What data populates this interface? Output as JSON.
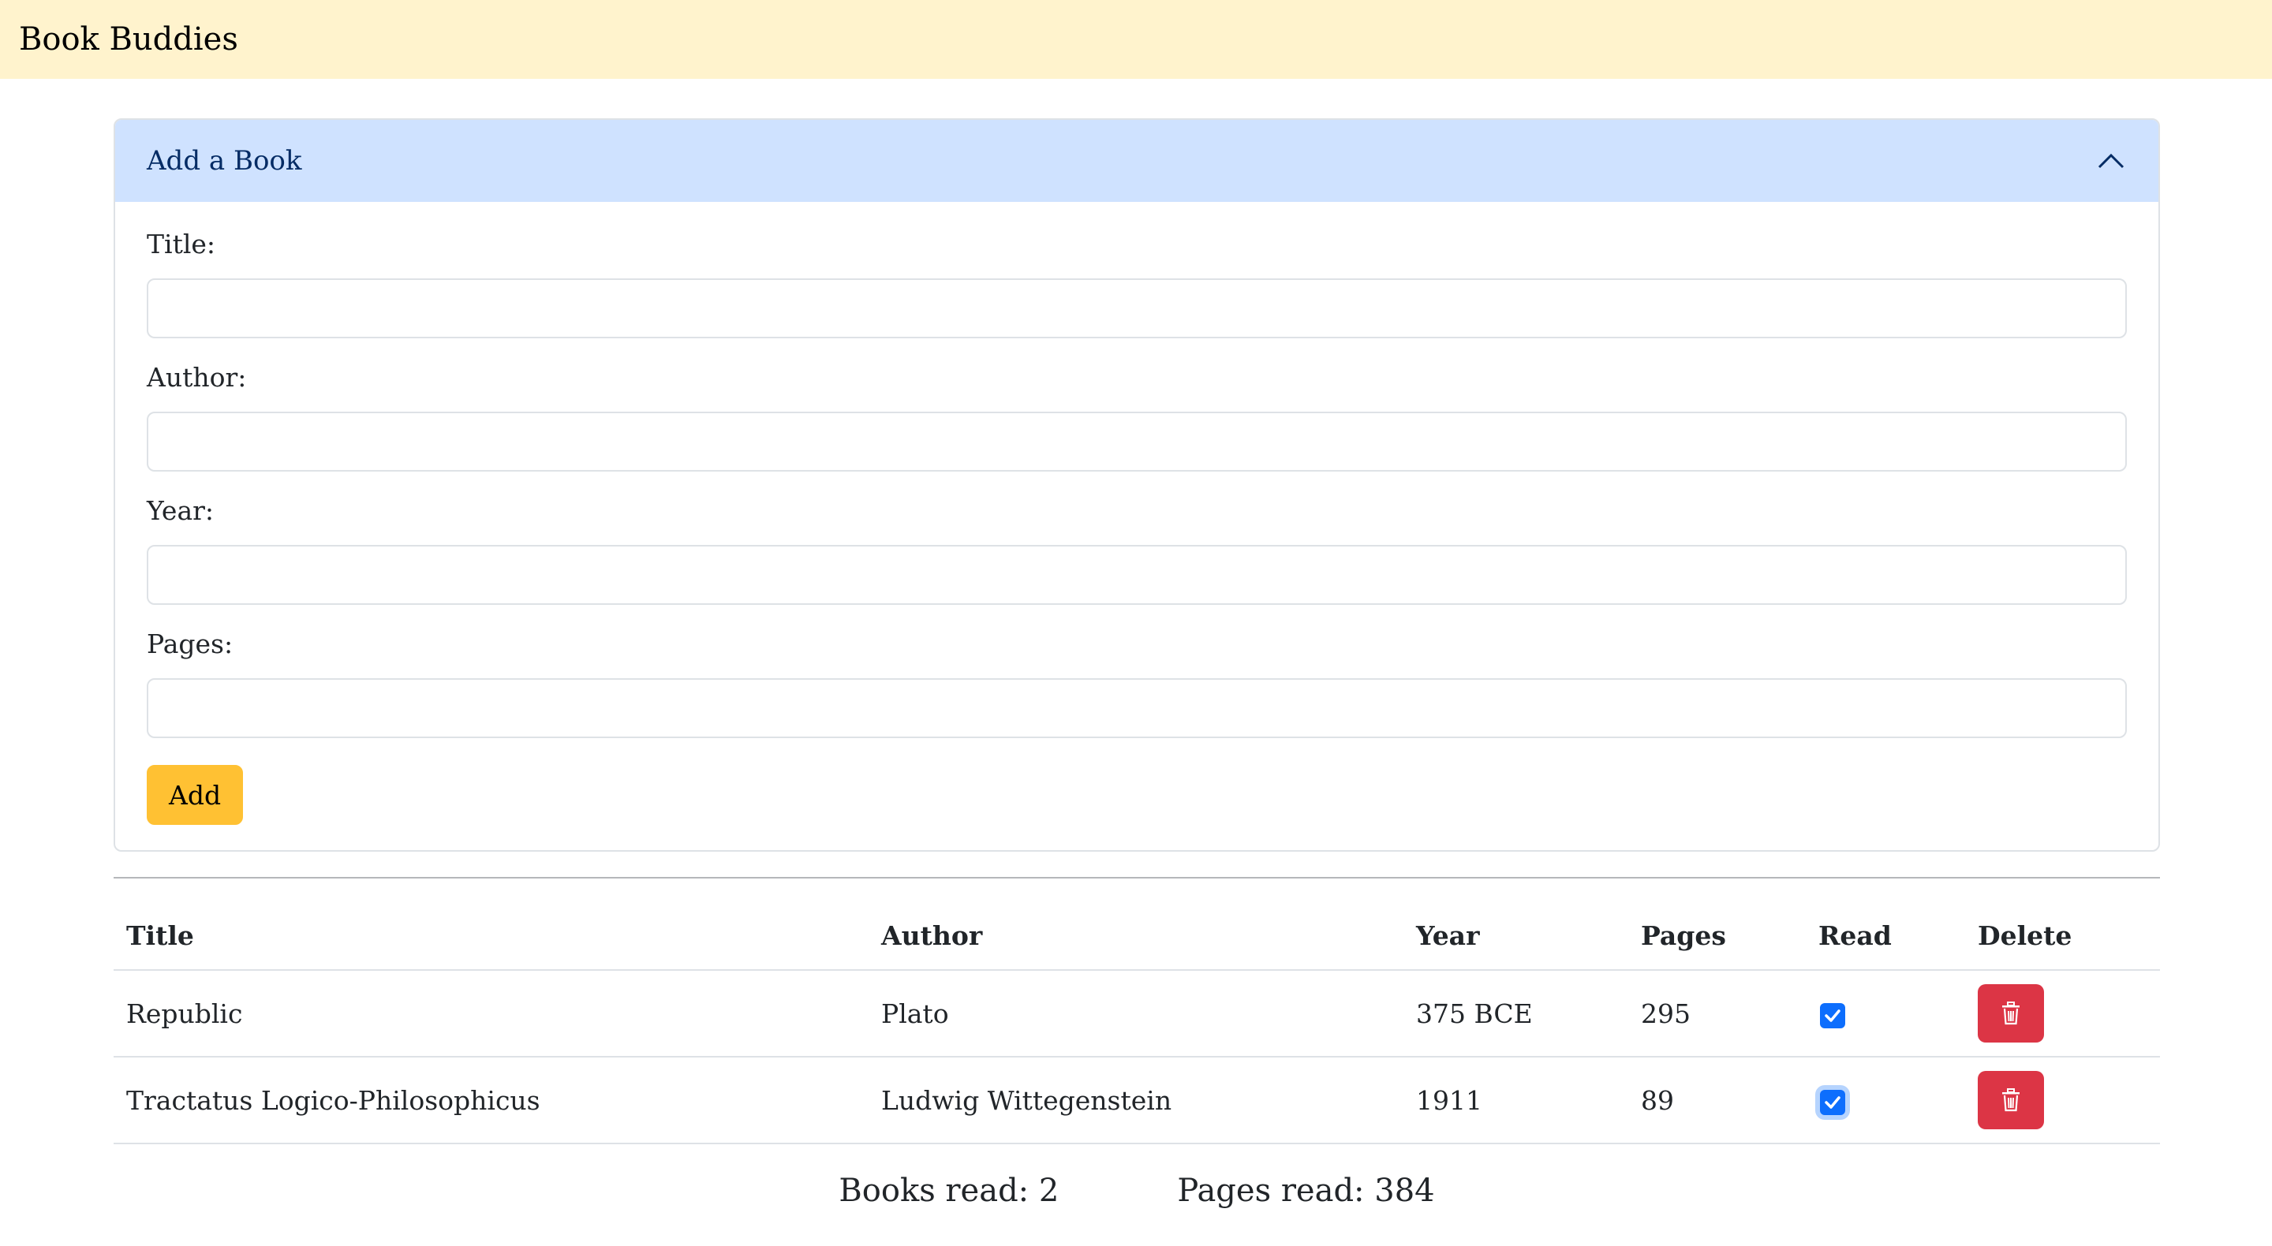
{
  "app": {
    "title": "Book Buddies"
  },
  "accordion": {
    "header": "Add a Book",
    "icon": "chevron-up-icon"
  },
  "form": {
    "fields": [
      {
        "label": "Title:",
        "value": "",
        "placeholder": ""
      },
      {
        "label": "Author:",
        "value": "",
        "placeholder": ""
      },
      {
        "label": "Year:",
        "value": "",
        "placeholder": ""
      },
      {
        "label": "Pages:",
        "value": "",
        "placeholder": ""
      }
    ],
    "add_label": "Add"
  },
  "table": {
    "headers": [
      "Title",
      "Author",
      "Year",
      "Pages",
      "Read",
      "Delete"
    ],
    "rows": [
      {
        "title": "Republic",
        "author": "Plato",
        "year": "375 BCE",
        "pages": "295",
        "read": true
      },
      {
        "title": "Tractatus Logico-Philosophicus",
        "author": "Ludwig Wittegenstein",
        "year": "1911",
        "pages": "89",
        "read": true
      }
    ]
  },
  "summary": {
    "books_read": "Books read: 2",
    "pages_read": "Pages read: 384"
  },
  "colors": {
    "header_bg": "#fff3cd",
    "accordion_header_bg": "#cfe2ff",
    "add_button": "#ffc133",
    "delete_button": "#dc3545",
    "checkbox": "#0d6efd"
  }
}
